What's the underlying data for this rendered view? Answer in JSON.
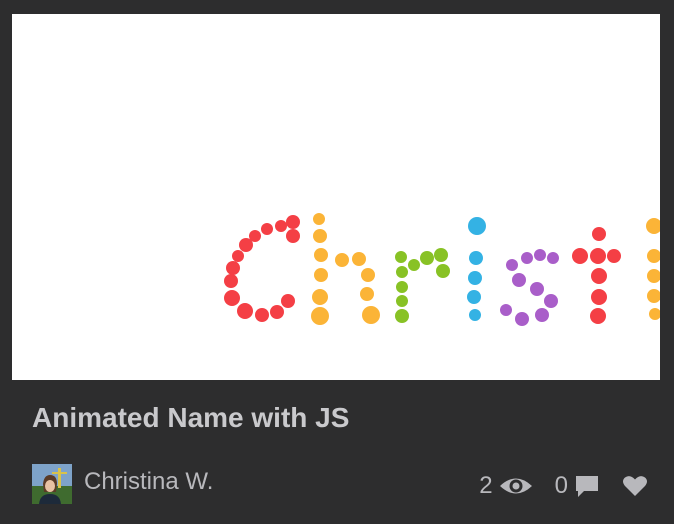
{
  "pen": {
    "title": "Animated Name with JS",
    "preview_text": "Christi"
  },
  "author": {
    "name": "Christina W."
  },
  "stats": {
    "views": "2",
    "comments": "0"
  },
  "colors": {
    "red": "#f43f45",
    "orange": "#fbb437",
    "green": "#88c225",
    "blue": "#34b2e4",
    "purple": "#a95ec9",
    "card_bg": "#2d2d2e",
    "text": "#b8b8bc"
  },
  "icons": {
    "views": "eye-icon",
    "comments": "speech-bubble-icon",
    "likes": "heart-icon"
  }
}
